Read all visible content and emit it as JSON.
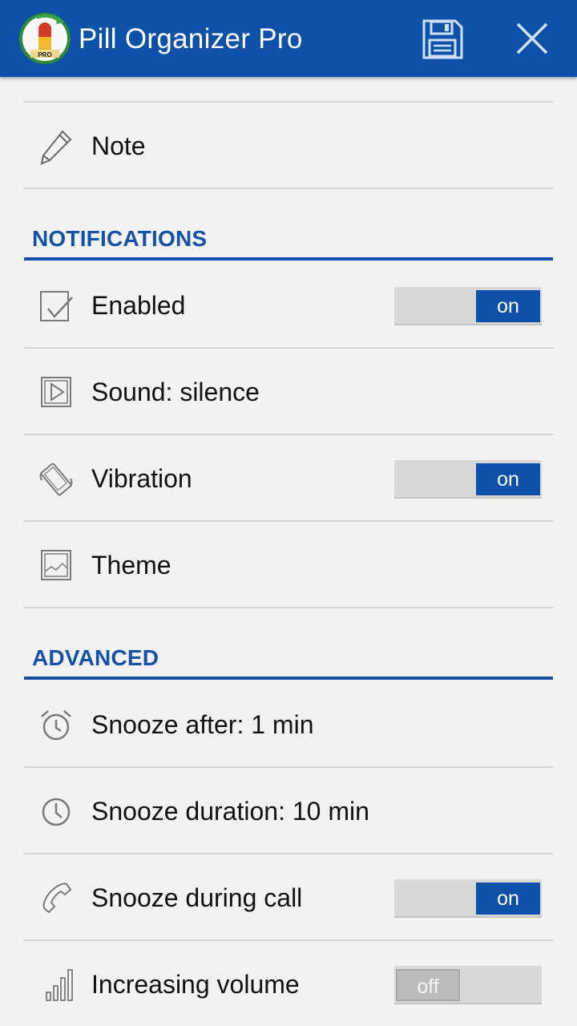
{
  "app": {
    "title": "Pill Organizer Pro",
    "brand_color": "#0d52a8",
    "logo_badge": "PRO"
  },
  "toolbar": {
    "save_icon": "save-icon",
    "close_icon": "close-icon"
  },
  "rows": {
    "note": {
      "label": "Note",
      "icon": "pencil-icon"
    },
    "enabled": {
      "label": "Enabled",
      "icon": "checkbox-icon",
      "toggle": "on"
    },
    "sound": {
      "label": "Sound: silence",
      "icon": "play-icon"
    },
    "vibration": {
      "label": "Vibration",
      "icon": "vibration-icon",
      "toggle": "on"
    },
    "theme": {
      "label": "Theme",
      "icon": "image-icon"
    },
    "snooze_after": {
      "label": "Snooze after: 1 min",
      "icon": "alarm-clock-icon"
    },
    "snooze_duration": {
      "label": "Snooze duration: 10 min",
      "icon": "clock-icon"
    },
    "snooze_call": {
      "label": "Snooze during call",
      "icon": "phone-icon",
      "toggle": "on"
    },
    "increasing_volume": {
      "label": "Increasing volume",
      "icon": "volume-bars-icon",
      "toggle": "off"
    }
  },
  "sections": {
    "notifications": "NOTIFICATIONS",
    "advanced": "ADVANCED"
  },
  "accent_color": "#1551a6"
}
